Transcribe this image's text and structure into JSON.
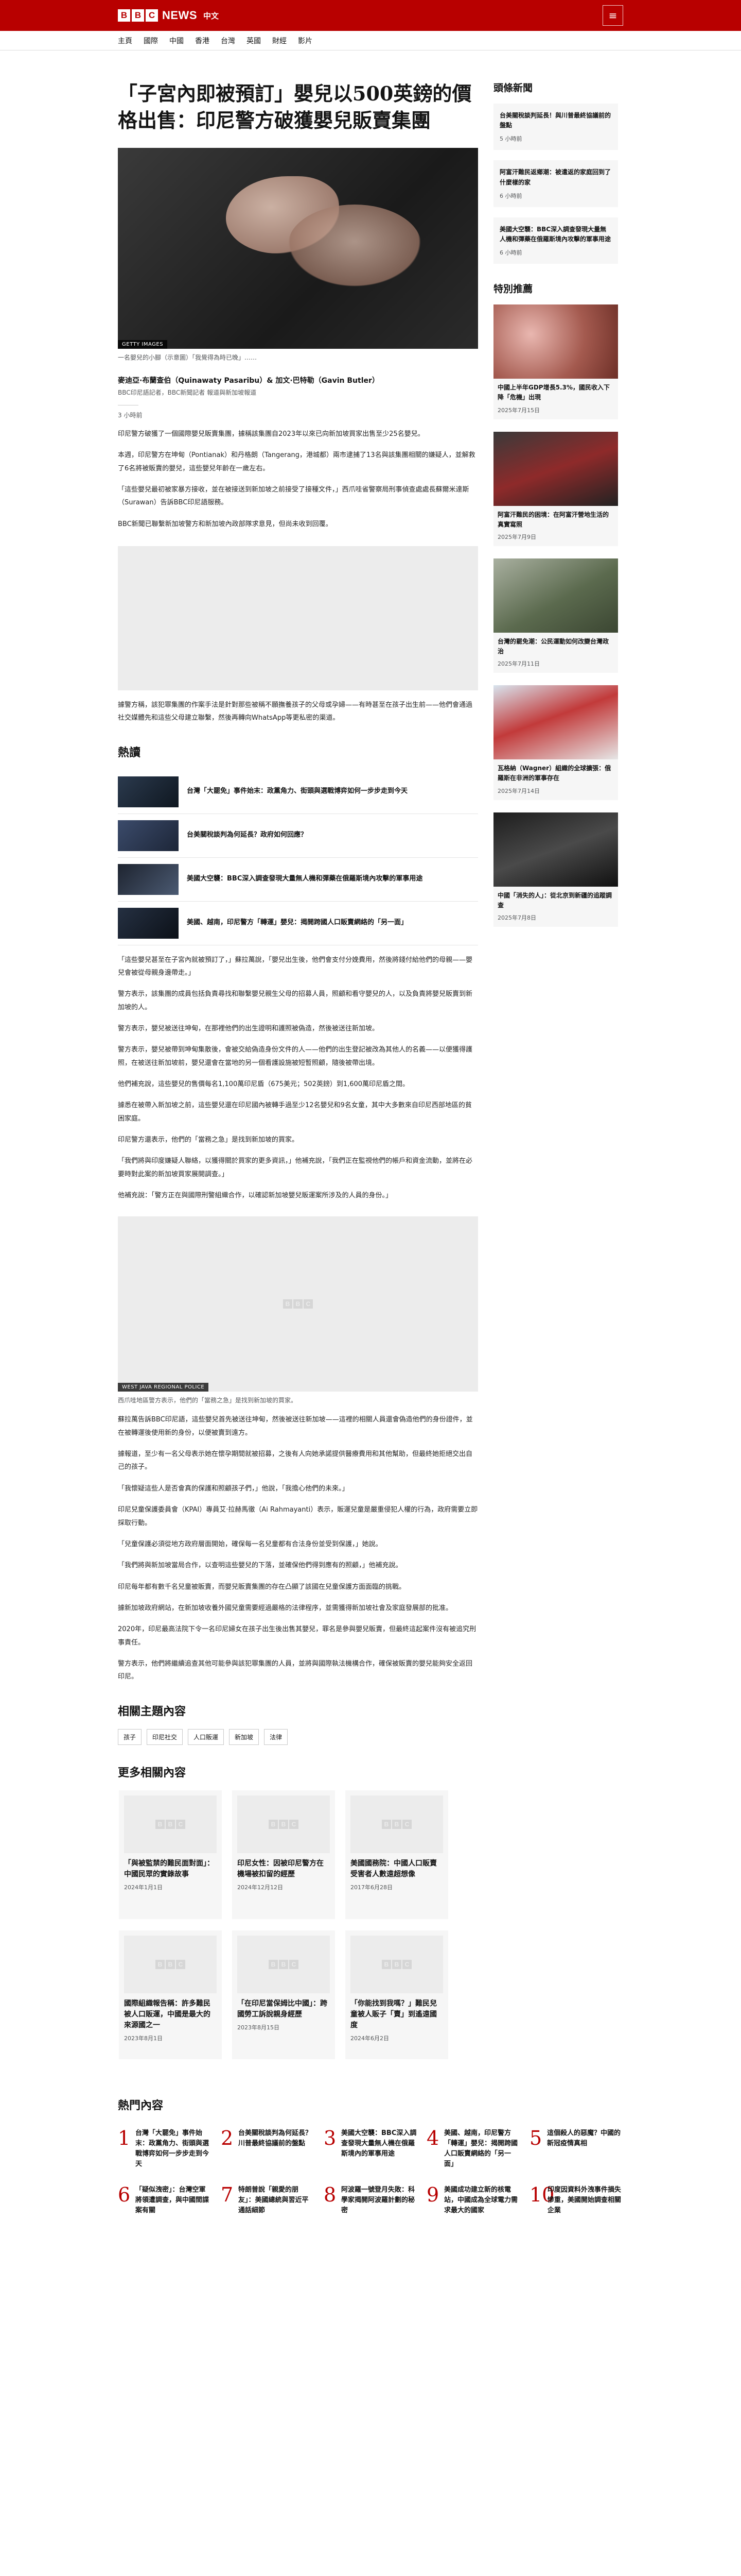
{
  "header": {
    "logo_letters": [
      "B",
      "B",
      "C"
    ],
    "logo_word": "NEWS",
    "logo_lang": "中文",
    "menu_icon": "hamburger-icon",
    "nav": [
      "主頁",
      "國際",
      "中國",
      "香港",
      "台灣",
      "英國",
      "財經",
      "影片"
    ]
  },
  "article": {
    "title": "「子宮內即被預訂」嬰兒以500英鎊的價格出售：印尼警方破獲嬰兒販賣集團",
    "hero_credit": "GETTY IMAGES",
    "hero_caption": "一名嬰兒的小腳（示意圖）「我覺得為時已晚」……",
    "authors": "麥迪亞·布蘭查伯（Quinawaty Pasaribu）& 加文·巴特勒（Gavin Butler）",
    "roles": "BBC印尼語記者，BBC新聞記者 報道與新加坡報道",
    "date": "3 小時前",
    "paragraphs": [
      "印尼警方破獲了一個國際嬰兒販賣集團，據稱該集團自2023年以來已向新加坡買家出售至少25名嬰兒。",
      "本週，印尼警方在坤甸（Pontianak）和丹格朗（Tangerang，港城都）兩市逮捕了13名與該集團相關的嫌疑人，並解救了6名將被販賣的嬰兒，這些嬰兒年齡在一歲左右。",
      "「這些嬰兒最初被家暴方接收，並在被接送到新加坡之前接受了接種文件，」西爪哇省警察局刑事偵查處處長蘇爾米達斯（Surawan）告訴BBC印尼語服務。",
      "BBC新聞已聯繫新加坡警方和新加坡內政部隊求意見，但尚未收到回覆。"
    ],
    "paragraphs_b": [
      "據警方稱，該犯罪集團的作案手法是針對那些被稱不願撫養孩子的父母或孕婦——有時甚至在孩子出生前——他們會通過社交媒體先和這些父母建立聯繫，然後再轉向WhatsApp等更私密的渠道。"
    ],
    "paragraphs_c": [
      "「這些嬰兒甚至在子宮內就被預訂了，」蘇拉萬說，「嬰兒出生後，他們會支付分娩費用，然後將錢付給他們的母親——嬰兒會被從母親身邊帶走。」",
      "警方表示，該集團的成員包括負責尋找和聯繫嬰兒親生父母的招募人員，照顧和看守嬰兒的人，以及負責將嬰兒販賣到新加坡的人。",
      "警方表示，嬰兒被送往坤甸，在那裡他們的出生證明和護照被偽造，然後被送往新加坡。",
      "警方表示，嬰兒被帶到坤甸集散後，會被交給偽造身份文件的人——他們的出生登記被改為其他人的名義——以便獲得護照，在被送往新加坡前，嬰兒還會在當地的另一個看護設施被短暫照顧，隨後被帶出境。",
      "他們補充說，這些嬰兒的售價每名1,100萬印尼盾（675美元；502英鎊）到1,600萬印尼盾之間。",
      "據悉在被帶入新加坡之前，這些嬰兒還在印尼國內被轉手過至少12名嬰兒和9名女童，其中大多數來自印尼西部地區的貧困家庭。",
      "印尼警方還表示，他們的「當務之急」是找到新加坡的買家。"
    ],
    "paragraphs_d": [
      "「我們將與印度嫌疑人聯絡，以獲得關於買家的更多資訊，」他補充說，「我們正在監視他們的帳戶和資金流動，並將在必要時對此案的新加坡買家展開調查。」",
      "他補充說：「警方正在與國際刑警組織合作，以確認新加坡嬰兒販運案所涉及的人員的身份。」"
    ],
    "fig2_credit": "WEST JAVA REGIONAL POLICE",
    "fig2_caption": "西爪哇地區警方表示，他們的「當務之急」是找到新加坡的買家。",
    "paragraphs_e": [
      "蘇拉萬告訴BBC印尼語，這些嬰兒首先被送往坤甸，然後被送往新加坡——這裡的相關人員還會偽造他們的身份證件，並在被轉運後使用新的身份，以便被賣到遠方。",
      "據報道，至少有一名父母表示她在懷孕期間就被招募，之後有人向她承諾提供醫療費用和其他幫助，但最終她拒絕交出自己的孩子。",
      "「我懷疑這些人是否會真的保護和照顧孩子們，」他說，「我擔心他們的未來。」",
      "印尼兒童保護委員會（KPAI）專員艾·拉赫馬徹（Ai Rahmayanti）表示，販運兒童是嚴重侵犯人權的行為，政府需要立即採取行動。",
      "「兒童保護必須從地方政府層面開始，確保每一名兒童都有合法身份並受到保護，」她說。",
      "「我們將與新加坡當局合作，以查明這些嬰兒的下落，並確保他們得到應有的照顧，」他補充說。",
      "印尼每年都有數千名兒童被販賣，而嬰兒販賣集團的存在凸顯了該國在兒童保護方面面臨的挑戰。",
      "據新加坡政府網站，在新加坡收養外國兒童需要經過嚴格的法律程序，並需獲得新加坡社會及家庭發展部的批准。",
      "2020年，印尼最高法院下令一名印尼婦女在孩子出生後出售其嬰兒，罪名是參與嬰兒販賣，但最終這起案件沒有被追究刑事責任。",
      "警方表示，他們將繼續追查其他可能參與該犯罪集團的人員，並將與國際執法機構合作，確保被販賣的嬰兒能夠安全返回印尼。"
    ],
    "related_heading": "相關主題內容",
    "topics": [
      "孩子",
      "印尼社交",
      "人口販運",
      "新加坡",
      "法律"
    ],
    "more_heading": "更多相關內容"
  },
  "trending": {
    "heading": "熱讀",
    "items": [
      "台灣「大罷免」事件始末：政黨角力、街頭與選戰博弈如何一步步走到今天",
      "台美關稅談判為何延長？政府如何回應？",
      "美國大空襲：BBC深入調查發現大量無人機和彈藥在俄羅斯境內攻擊的軍事用途",
      "美國、越南，印尼警方「轉運」嬰兒：揭開跨國人口販賣網絡的「另一面」"
    ]
  },
  "related_cards": [
    {
      "title": "「與被監禁的難民面對面」：中國民眾的實錄故事",
      "date": "2024年1月1日"
    },
    {
      "title": "印尼女性：因被印尼警方在機場被扣留的經歷",
      "date": "2024年12月12日"
    },
    {
      "title": "美國國務院：中國人口販賣受害者人數遠超想像",
      "date": "2017年6月28日"
    },
    {
      "title": "國際組織報告稱：許多難民被人口販運，中國是最大的來源國之一",
      "date": "2023年8月1日"
    },
    {
      "title": "「在印尼當保姆比中國」：跨國勞工訴說親身經歷",
      "date": "2023年8月15日"
    },
    {
      "title": "「你能找到我嗎？」難民兒童被人販子「賣」到遙遠國度",
      "date": "2024年6月2日"
    }
  ],
  "sidebar": {
    "news_heading": "頭條新聞",
    "news": [
      {
        "title": "台美關稅談判延長！與川普最終協議前的盤點",
        "date": "5 小時前"
      },
      {
        "title": "阿富汗難民返鄉潮：被遣返的家庭回到了什麼樣的家",
        "date": "6 小時前"
      },
      {
        "title": "美國大空襲：BBC深入調查發現大量無人機和彈藥在俄羅斯境內攻擊的軍事用途",
        "date": "6 小時前"
      }
    ],
    "rec_heading": "特別推薦",
    "recs": [
      {
        "title": "中國上半年GDP增長5.3%，國民收入下降「危機」出現",
        "date": "2025年7月15日"
      },
      {
        "title": "阿富汗難民的困境：在阿富汗營地生活的真實寫照",
        "date": "2025年7月9日"
      },
      {
        "title": "台灣的罷免潮：公民運動如何改變台灣政治",
        "date": "2025年7月11日"
      },
      {
        "title": "瓦格納（Wagner）組織的全球擴張：俄羅斯在非洲的軍事存在",
        "date": "2025年7月14日"
      },
      {
        "title": "中國「消失的人」：從北京到新疆的追蹤調查",
        "date": "2025年7月8日"
      }
    ]
  },
  "most_read": {
    "heading": "熱門內容",
    "items": [
      {
        "num": "1",
        "title": "台灣「大罷免」事件始末：政黨角力、街頭與選戰博弈如何一步步走到今天"
      },
      {
        "num": "2",
        "title": "台美關稅談判為何延長？川普最終協議前的盤點"
      },
      {
        "num": "3",
        "title": "美國大空襲：BBC深入調查發現大量無人機在俄羅斯境內的軍事用途"
      },
      {
        "num": "4",
        "title": "美國、越南，印尼警方「轉運」嬰兒：揭開跨國人口販賣網絡的「另一面」"
      },
      {
        "num": "5",
        "title": "這個殺人的惡魔？中國的新冠疫情真相"
      },
      {
        "num": "6",
        "title": "「疑似洩密」：台灣空軍將領遭調查，與中國間諜案有關"
      },
      {
        "num": "7",
        "title": "特朗普說「親愛的朋友」：美國總統與習近平通話細節"
      },
      {
        "num": "8",
        "title": "阿波羅一號登月失敗：科學家揭開阿波羅計劃的秘密"
      },
      {
        "num": "9",
        "title": "美國成功建立新的核電站，中國成為全球電力需求最大的國家"
      },
      {
        "num": "10",
        "title": "印度因資料外洩事件損失慘重，美國開始調查相關企業"
      }
    ]
  },
  "colors": {
    "brand": "#b80000",
    "text": "#141414",
    "muted": "#545658"
  }
}
